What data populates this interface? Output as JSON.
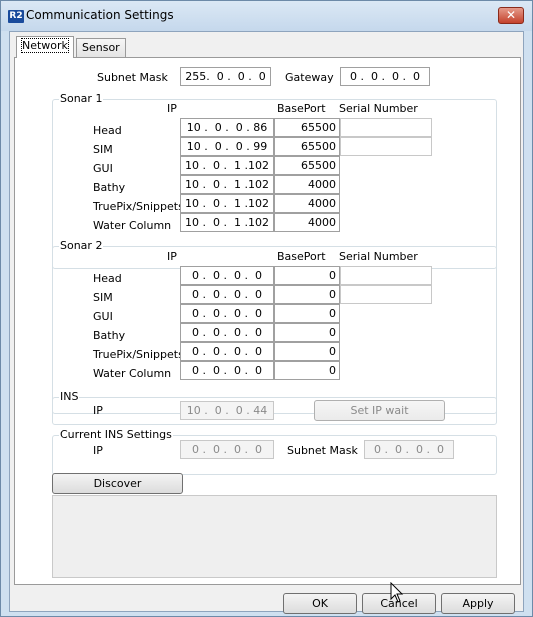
{
  "window": {
    "title": "Communication Settings",
    "icon_text": "R2",
    "close_icon": "close-icon"
  },
  "tabs": [
    {
      "label": "Network",
      "selected": true
    },
    {
      "label": "Sensor",
      "selected": false
    }
  ],
  "network": {
    "subnet_mask_label": "Subnet Mask",
    "subnet_mask_value": "255.  0 .  0 .  0",
    "gateway_label": "Gateway",
    "gateway_value": "0 .  0 .  0 .  0"
  },
  "sonar1": {
    "title": "Sonar 1",
    "col_ip": "IP",
    "col_baseport": "BasePort",
    "col_serial": "Serial Number",
    "rows": [
      {
        "label": "Head",
        "ip": "10 .  0 .  0 . 86",
        "port": "65500",
        "serial": ""
      },
      {
        "label": "SIM",
        "ip": "10 .  0 .  0 . 99",
        "port": "65500",
        "serial": ""
      },
      {
        "label": "GUI",
        "ip": "10 .  0 .  1 .102",
        "port": "65500"
      },
      {
        "label": "Bathy",
        "ip": "10 .  0 .  1 .102",
        "port": "4000"
      },
      {
        "label": "TruePix/Snippets",
        "ip": "10 .  0 .  1 .102",
        "port": "4000"
      },
      {
        "label": "Water Column",
        "ip": "10 .  0 .  1 .102",
        "port": "4000"
      }
    ]
  },
  "sonar2": {
    "title": "Sonar 2",
    "col_ip": "IP",
    "col_baseport": "BasePort",
    "col_serial": "Serial Number",
    "rows": [
      {
        "label": "Head",
        "ip": "0 .  0 .  0 .  0",
        "port": "0",
        "serial": ""
      },
      {
        "label": "SIM",
        "ip": "0 .  0 .  0 .  0",
        "port": "0",
        "serial": ""
      },
      {
        "label": "GUI",
        "ip": "0 .  0 .  0 .  0",
        "port": "0"
      },
      {
        "label": "Bathy",
        "ip": "0 .  0 .  0 .  0",
        "port": "0"
      },
      {
        "label": "TruePix/Snippets",
        "ip": "0 .  0 .  0 .  0",
        "port": "0"
      },
      {
        "label": "Water Column",
        "ip": "0 .  0 .  0 .  0",
        "port": "0"
      }
    ]
  },
  "ins": {
    "title": "INS",
    "ip_label": "IP",
    "ip_value": "10 .  0 .  0 . 44",
    "set_ip_wait_label": "Set IP wait"
  },
  "current_ins": {
    "title": "Current INS Settings",
    "ip_label": "IP",
    "ip_value": "0 .  0 .  0 .  0",
    "subnet_mask_label": "Subnet Mask",
    "subnet_mask_value": "0 .  0 .  0 .  0"
  },
  "discover_label": "Discover",
  "footer": {
    "ok_label": "OK",
    "cancel_label": "Cancel",
    "apply_label": "Apply"
  }
}
